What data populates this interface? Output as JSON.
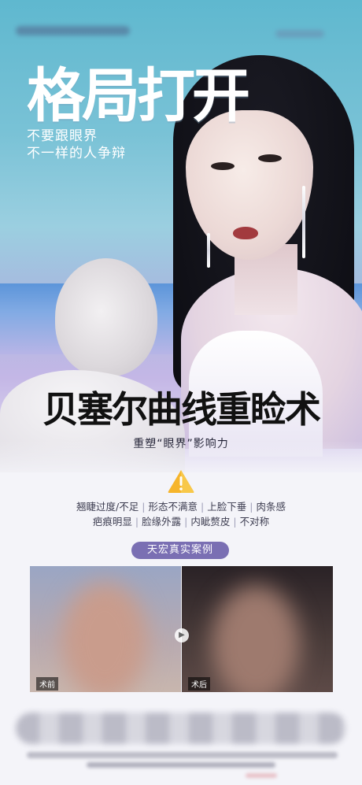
{
  "hero": {
    "big_title": "格局打开",
    "subtitle_line1": "不要跟眼界",
    "subtitle_line2": "不一样的人争辩",
    "main_title": "贝塞尔曲线重睑术",
    "main_subtitle": "重塑“眼界”影响力"
  },
  "concerns": {
    "row1": [
      "翘睫过度/不足",
      "形态不满意",
      "上脸下垂",
      "肉条感"
    ],
    "row2": [
      "疤痕明显",
      "脸缘外露",
      "内眦赘皮",
      "不对称"
    ]
  },
  "cases": {
    "title": "天宏真实案例",
    "before_label": "术前",
    "after_label": "术后"
  },
  "icons": {
    "warning": "warning-icon",
    "arrow": "chevron-right-icon"
  },
  "colors": {
    "pill": "#7a6fb3",
    "hero_top": "#5fb8cf",
    "hero_bottom": "#c4b7e6"
  }
}
